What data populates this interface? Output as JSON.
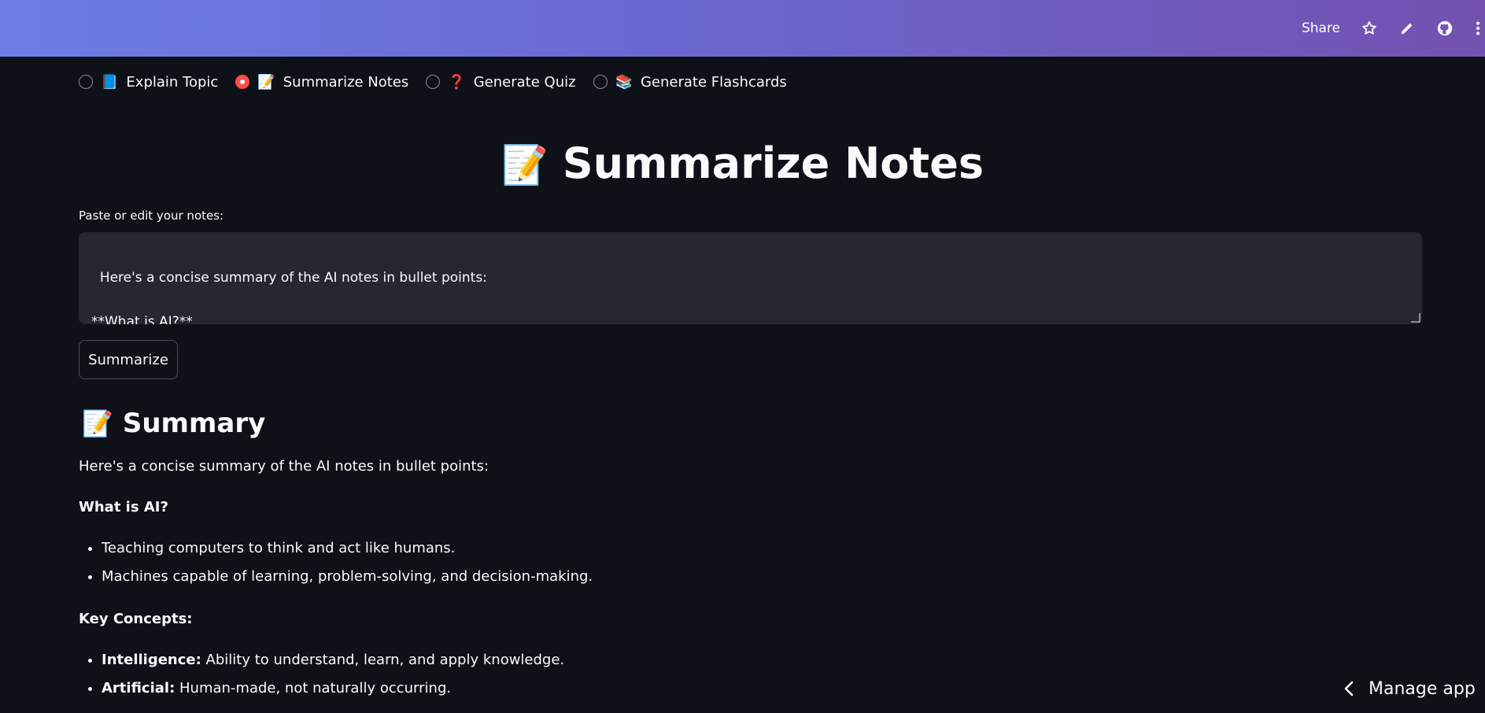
{
  "header": {
    "share_label": "Share",
    "icons": [
      "star-icon",
      "pencil-icon",
      "github-icon",
      "more-vertical-icon"
    ]
  },
  "mode_radio": {
    "options": [
      {
        "emoji": "📘",
        "label": "Explain Topic",
        "selected": false
      },
      {
        "emoji": "📝",
        "label": "Summarize Notes",
        "selected": true
      },
      {
        "emoji": "❓",
        "label": "Generate Quiz",
        "selected": false
      },
      {
        "emoji": "📚",
        "label": "Generate Flashcards",
        "selected": false
      }
    ],
    "accent_color": "#ff4b4b"
  },
  "page": {
    "title_emoji": "📝",
    "title": "Summarize Notes"
  },
  "notes_input": {
    "label": "Paste or edit your notes:",
    "value": "Here's a concise summary of the AI notes in bullet points:\n\n**What is AI?**"
  },
  "summarize_button": {
    "label": "Summarize"
  },
  "summary": {
    "heading_emoji": "📝",
    "heading": "Summary",
    "intro": "Here's a concise summary of the AI notes in bullet points:",
    "section1_title": "What is AI?",
    "section1_items": [
      "Teaching computers to think and act like humans.",
      "Machines capable of learning, problem-solving, and decision-making."
    ],
    "section2_title": "Key Concepts:",
    "section2_items": [
      {
        "term": "Intelligence:",
        "text": " Ability to understand, learn, and apply knowledge."
      },
      {
        "term": "Artificial:",
        "text": " Human-made, not naturally occurring."
      }
    ]
  },
  "footer": {
    "manage_app_label": "Manage app"
  }
}
